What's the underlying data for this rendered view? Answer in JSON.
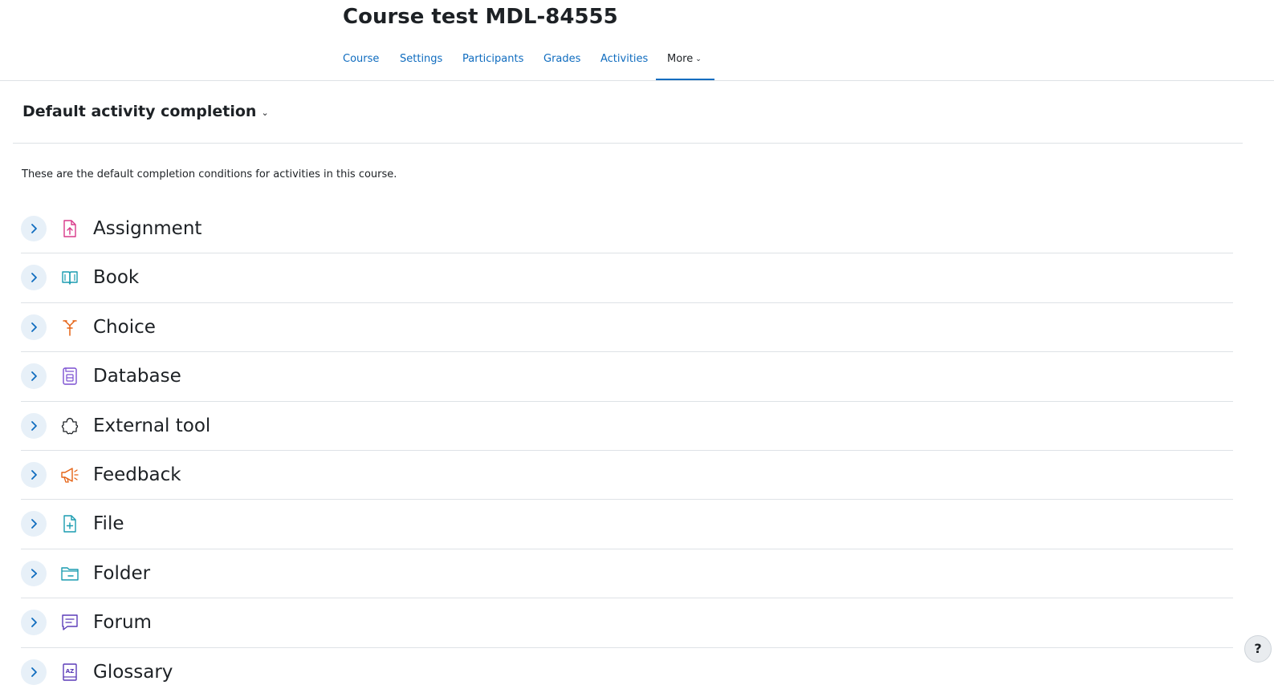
{
  "course": {
    "title": "Course test MDL-84555"
  },
  "nav": {
    "tabs": [
      {
        "label": "Course"
      },
      {
        "label": "Settings"
      },
      {
        "label": "Participants"
      },
      {
        "label": "Grades"
      },
      {
        "label": "Activities"
      },
      {
        "label": "More",
        "active": true
      }
    ]
  },
  "page": {
    "heading": "Default activity completion",
    "intro": "These are the default completion conditions for activities in this course."
  },
  "activities": [
    {
      "name": "Assignment",
      "icon": "assignment-icon",
      "color": "#d83a8a"
    },
    {
      "name": "Book",
      "icon": "book-icon",
      "color": "#1a9cb0"
    },
    {
      "name": "Choice",
      "icon": "choice-icon",
      "color": "#e56315"
    },
    {
      "name": "Database",
      "icon": "database-icon",
      "color": "#7a4fd1"
    },
    {
      "name": "External tool",
      "icon": "external-tool-icon",
      "color": "#1d2125"
    },
    {
      "name": "Feedback",
      "icon": "feedback-icon",
      "color": "#e56315"
    },
    {
      "name": "File",
      "icon": "file-icon",
      "color": "#1a9cb0"
    },
    {
      "name": "Folder",
      "icon": "folder-icon",
      "color": "#1a9cb0"
    },
    {
      "name": "Forum",
      "icon": "forum-icon",
      "color": "#5b3bb8"
    },
    {
      "name": "Glossary",
      "icon": "glossary-icon",
      "color": "#5b3bb8"
    }
  ],
  "help": {
    "label": "?"
  },
  "colors": {
    "link": "#0f6cbf",
    "text": "#1d2125",
    "border": "#dee2e6"
  }
}
